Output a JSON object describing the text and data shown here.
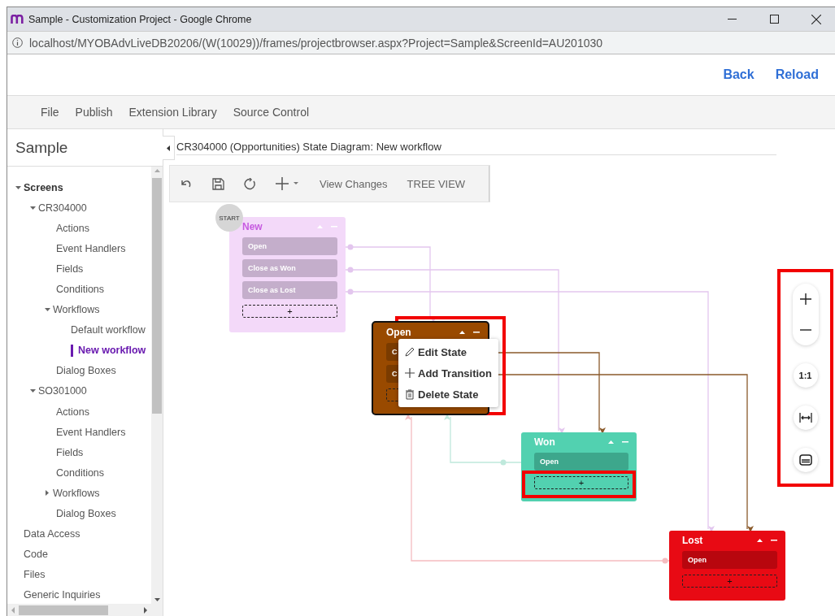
{
  "window": {
    "title": "Sample - Customization Project - Google Chrome"
  },
  "address_bar": {
    "url": "localhost/MYOBAdvLiveDB20206/(W(10029))/frames/projectbrowser.aspx?Project=Sample&ScreenId=AU201030"
  },
  "header_links": [
    "Back",
    "Reload"
  ],
  "menu_bar": [
    "File",
    "Publish",
    "Extension Library",
    "Source Control"
  ],
  "sidebar": {
    "title": "Sample",
    "tree": [
      {
        "label": "Screens",
        "expanded": true,
        "selected": false,
        "children": [
          {
            "label": "CR304000",
            "expanded": true,
            "selected": false,
            "children": [
              {
                "label": "Actions",
                "selected": false
              },
              {
                "label": "Event Handlers",
                "selected": false
              },
              {
                "label": "Fields",
                "selected": false
              },
              {
                "label": "Conditions",
                "selected": false
              },
              {
                "label": "Workflows",
                "expanded": true,
                "selected": false,
                "children": [
                  {
                    "label": "Default workflow",
                    "selected": false
                  },
                  {
                    "label": "New workflow",
                    "selected": true
                  }
                ]
              },
              {
                "label": "Dialog Boxes",
                "selected": false
              }
            ]
          },
          {
            "label": "SO301000",
            "expanded": true,
            "selected": false,
            "children": [
              {
                "label": "Actions",
                "selected": false
              },
              {
                "label": "Event Handlers",
                "selected": false
              },
              {
                "label": "Fields",
                "selected": false
              },
              {
                "label": "Conditions",
                "selected": false
              },
              {
                "label": "Workflows",
                "expanded": false,
                "selected": false
              },
              {
                "label": "Dialog Boxes",
                "selected": false
              }
            ]
          }
        ]
      },
      {
        "label": "Data Access",
        "selected": false
      },
      {
        "label": "Code",
        "selected": false
      },
      {
        "label": "Files",
        "selected": false
      },
      {
        "label": "Generic Inquiries",
        "selected": false
      }
    ]
  },
  "diagram": {
    "title": "CR304000 (Opportunities) State Diagram: New workflow",
    "toolbar_buttons": [
      "View Changes",
      "TREE VIEW"
    ],
    "start_label": "START",
    "states": [
      {
        "name": "New",
        "color": "#f3d9f9",
        "transitions": [
          "Open",
          "Close as Won",
          "Close as Lost"
        ],
        "add_label": "+"
      },
      {
        "name": "Open",
        "color": "#994a00",
        "transitions": [
          "C",
          "C"
        ]
      },
      {
        "name": "Won",
        "color": "#52d1b0",
        "transitions": [
          "Open"
        ],
        "add_label": "+"
      },
      {
        "name": "Lost",
        "color": "#e80a14",
        "transitions": [
          "Open"
        ],
        "add_label": "+"
      }
    ],
    "context_menu": [
      {
        "kind": "edit",
        "label": "Edit State"
      },
      {
        "kind": "add",
        "label": "Add Transition"
      },
      {
        "kind": "delete",
        "label": "Delete State"
      }
    ],
    "zoom_controls": {
      "reset_label": "1:1"
    }
  }
}
